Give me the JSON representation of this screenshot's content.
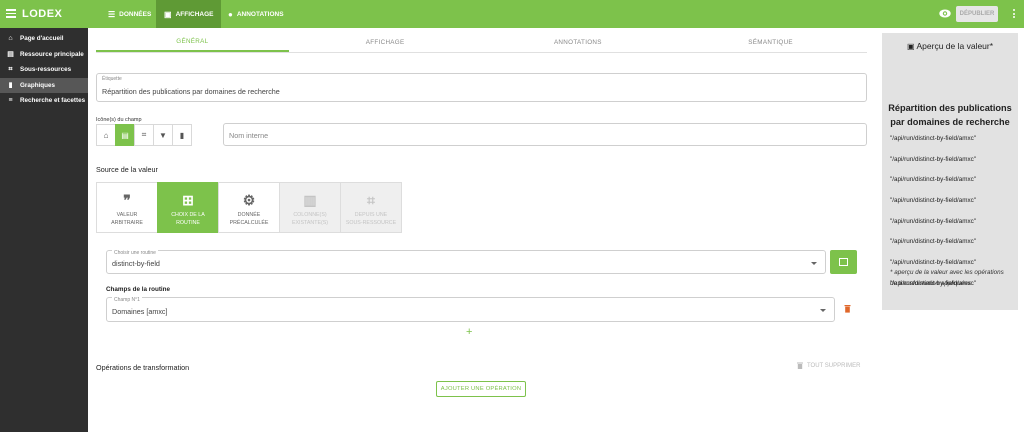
{
  "app": {
    "logo": "LODEX",
    "publish_label": "DÉPUBLIER"
  },
  "topnav": [
    {
      "label": "DONNÉES",
      "icon": "list-icon"
    },
    {
      "label": "AFFICHAGE",
      "icon": "display-icon"
    },
    {
      "label": "ANNOTATIONS",
      "icon": "comment-icon"
    }
  ],
  "sidebar": [
    {
      "label": "Page d'accueil",
      "icon": "home-icon"
    },
    {
      "label": "Ressource principale",
      "icon": "document-icon"
    },
    {
      "label": "Sous-ressources",
      "icon": "subresource-icon"
    },
    {
      "label": "Graphiques",
      "icon": "chart-icon"
    },
    {
      "label": "Recherche et facettes",
      "icon": "search-icon"
    }
  ],
  "tabs": [
    "GÉNÉRAL",
    "AFFICHAGE",
    "ANNOTATIONS",
    "SÉMANTIQUE"
  ],
  "form": {
    "etiquette_label": "Étiquette",
    "etiquette_value": "Répartition des publications par domaines de recherche",
    "icons_label": "Icône(s) du champ",
    "nom_interne_placeholder": "Nom interne"
  },
  "source": {
    "title": "Source de la valeur",
    "options": [
      {
        "l1": "VALEUR",
        "l2": "ARBITRAIRE",
        "state": "normal",
        "icon": "quote-icon"
      },
      {
        "l1": "CHOIX DE LA",
        "l2": "ROUTINE",
        "state": "active",
        "icon": "routine-icon"
      },
      {
        "l1": "DONNÉE",
        "l2": "PRÉCALCULÉE",
        "state": "normal",
        "icon": "gear-icon"
      },
      {
        "l1": "COLONNE(S)",
        "l2": "EXISTANTE(S)",
        "state": "disabled",
        "icon": "columns-icon"
      },
      {
        "l1": "DEPUIS UNE",
        "l2": "SOUS-RESSOURCE",
        "state": "disabled",
        "icon": "subresource-icon"
      }
    ]
  },
  "routine": {
    "label": "Choisir une routine",
    "value": "distinct-by-field",
    "fields_title": "Champs de la routine",
    "field1_label": "Champ N°1",
    "field1_value": "Domaines [amxc]"
  },
  "operations": {
    "title": "Opérations de transformation",
    "delete_all": "TOUT SUPPRIMER",
    "add": "AJOUTER UNE OPÉRATION"
  },
  "preview": {
    "title": "Aperçu de la valeur*",
    "heading": "Répartition des publications par domaines de recherche",
    "lines": [
      "\"/api/run/distinct-by-field/amxc\"",
      "\"/api/run/distinct-by-field/amxc\"",
      "\"/api/run/distinct-by-field/amxc\"",
      "\"/api/run/distinct-by-field/amxc\"",
      "\"/api/run/distinct-by-field/amxc\"",
      "\"/api/run/distinct-by-field/amxc\"",
      "\"/api/run/distinct-by-field/amxc\"",
      "\"/api/run/distinct-by-field/amxc\""
    ],
    "note": "* aperçu de la valeur avec les opérations de transformation appliquées"
  },
  "colors": {
    "accent": "#7dc24b",
    "sidebar": "#2f2f2f",
    "preview_bg": "#e2e2e2"
  }
}
